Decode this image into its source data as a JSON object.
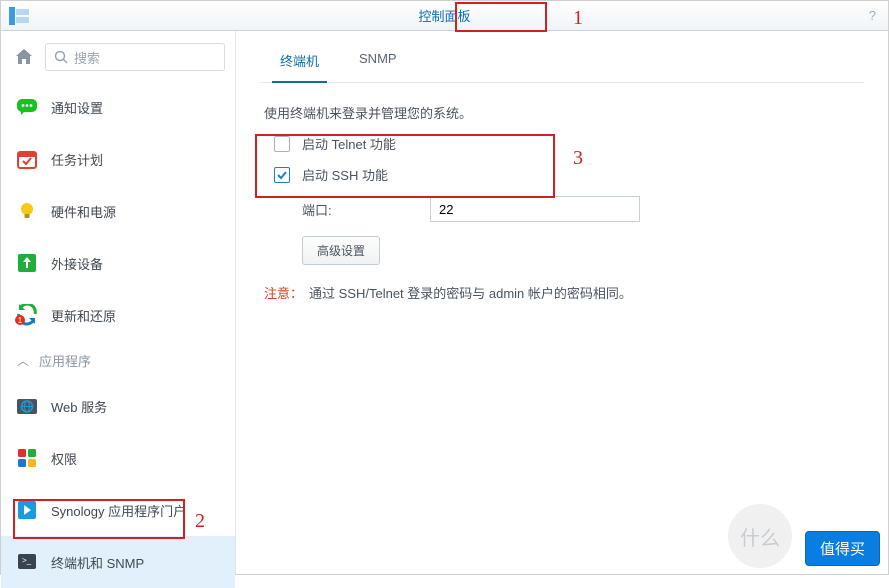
{
  "titlebar": {
    "title": "控制面板",
    "help": "?"
  },
  "search": {
    "placeholder": "搜索"
  },
  "sidebar": {
    "items": [
      {
        "label": "通知设置"
      },
      {
        "label": "任务计划"
      },
      {
        "label": "硬件和电源"
      },
      {
        "label": "外接设备"
      },
      {
        "label": "更新和还原"
      }
    ],
    "apps_header": "应用程序",
    "apps": [
      {
        "label": "Web 服务"
      },
      {
        "label": "权限"
      },
      {
        "label": "Synology 应用程序门户"
      },
      {
        "label": "终端机和 SNMP"
      }
    ]
  },
  "tabs": {
    "terminal": "终端机",
    "snmp": "SNMP"
  },
  "panel": {
    "intro": "使用终端机来登录并管理您的系统。",
    "telnet": "启动 Telnet 功能",
    "ssh": "启动 SSH 功能",
    "port_label": "端口:",
    "port_value": "22",
    "advanced": "高级设置",
    "note_label": "注意：",
    "note_text": "通过 SSH/Telnet 登录的密码与 admin 帐户的密码相同。"
  },
  "annotations": {
    "a1": "1",
    "a2": "2",
    "a3": "3"
  },
  "watermark": {
    "text": "什么",
    "button": "值得买"
  }
}
